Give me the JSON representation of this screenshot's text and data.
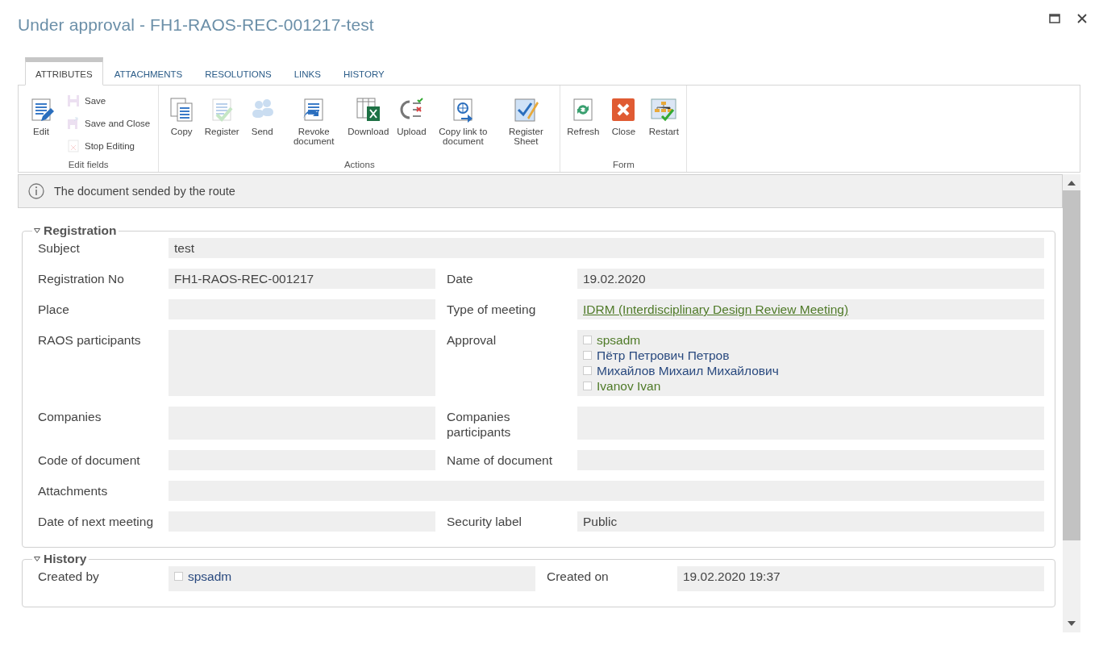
{
  "window": {
    "title": "Under approval - FH1-RAOS-REC-001217-test"
  },
  "tabs": [
    {
      "label": "ATTRIBUTES",
      "selected": true
    },
    {
      "label": "ATTACHMENTS",
      "selected": false
    },
    {
      "label": "RESOLUTIONS",
      "selected": false
    },
    {
      "label": "LINKS",
      "selected": false
    },
    {
      "label": "HISTORY",
      "selected": false
    }
  ],
  "ribbon": [
    {
      "title": "Edit fields",
      "large": [
        {
          "label": "Edit",
          "disabled": false
        }
      ],
      "small": [
        {
          "label": "Save",
          "disabled": true
        },
        {
          "label": "Save and Close",
          "disabled": true
        },
        {
          "label": "Stop Editing",
          "disabled": true
        }
      ]
    },
    {
      "title": "Actions",
      "large": [
        {
          "label": "Copy",
          "disabled": false
        },
        {
          "label": "Register",
          "disabled": true
        },
        {
          "label": "Send",
          "disabled": true
        },
        {
          "label": "Revoke document",
          "disabled": false
        },
        {
          "label": "Download",
          "disabled": false
        },
        {
          "label": "Upload",
          "disabled": false
        },
        {
          "label": "Copy link to document",
          "disabled": false
        },
        {
          "label": "Register Sheet",
          "disabled": false
        }
      ]
    },
    {
      "title": "Form",
      "large": [
        {
          "label": "Refresh",
          "disabled": false
        },
        {
          "label": "Close",
          "disabled": false
        },
        {
          "label": "Restart",
          "disabled": false
        }
      ]
    }
  ],
  "notice": "The document sended by the route",
  "sections": [
    {
      "title": "Registration",
      "expanded": true,
      "rows": [
        {
          "kind": "full",
          "fields": [
            {
              "label": "Subject",
              "kind": "text",
              "value": "test"
            }
          ]
        },
        {
          "kind": "pair",
          "fields": [
            {
              "label": "Registration No",
              "kind": "text",
              "value": "FH1-RAOS-REC-001217"
            },
            {
              "label": "Date",
              "kind": "text",
              "value": "19.02.2020"
            }
          ]
        },
        {
          "kind": "pair",
          "fields": [
            {
              "label": "Place",
              "kind": "text"
            },
            {
              "label": "Type of meeting",
              "kind": "link",
              "value": "IDRM (Interdisciplinary Design Review Meeting)"
            }
          ]
        },
        {
          "kind": "pair",
          "fields": [
            {
              "label": "RAOS participants",
              "kind": "text"
            },
            {
              "label": "Approval",
              "kind": "users",
              "users": [
                {
                  "name": "spsadm",
                  "color": "#4f7a28"
                },
                {
                  "name": "Пётр Петрович Петров",
                  "color": "#2a4a7f"
                },
                {
                  "name": "Михайлов Михаил Михайлович",
                  "color": "#2a4a7f"
                },
                {
                  "name": "Ivanov Ivan",
                  "color": "#4f7a28"
                }
              ]
            }
          ]
        },
        {
          "kind": "pair",
          "fields": [
            {
              "label": "Companies",
              "kind": "text"
            },
            {
              "label": "Companies participants",
              "kind": "text"
            }
          ]
        },
        {
          "kind": "pair",
          "fields": [
            {
              "label": "Code of document",
              "kind": "text"
            },
            {
              "label": "Name of document",
              "kind": "text"
            }
          ]
        },
        {
          "kind": "full",
          "fields": [
            {
              "label": "Attachments",
              "kind": "text"
            }
          ]
        },
        {
          "kind": "pair",
          "fields": [
            {
              "label": "Date of next meeting",
              "kind": "text"
            },
            {
              "label": "Security label",
              "kind": "text",
              "value": "Public"
            }
          ]
        }
      ]
    },
    {
      "title": "History",
      "expanded": true,
      "rows": [
        {
          "kind": "wide",
          "fields": [
            {
              "label": "Created by",
              "kind": "users",
              "users": [
                {
                  "name": "spsadm",
                  "color": "#2a4a7f"
                }
              ]
            },
            {
              "label": "Created on",
              "kind": "text",
              "value": "19.02.2020 19:37"
            }
          ]
        }
      ]
    }
  ]
}
